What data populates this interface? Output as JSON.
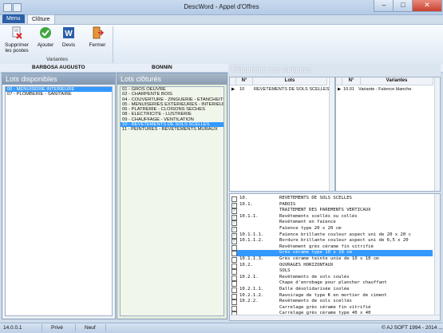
{
  "window": {
    "title": "DescWord - Appel d'Offres"
  },
  "ribbon": {
    "tabs": [
      "Menu",
      "Clôture"
    ],
    "buttons": {
      "supprimer": "Supprimer les postes",
      "ajouter": "Ajouter",
      "devis": "Devis",
      "fermer": "Fermer"
    },
    "group_label": "Variantes"
  },
  "header": {
    "left_name": "BARBOSA AUGUSTO",
    "mid_name": "BONNIN"
  },
  "lots_disponibles": {
    "title": "Lots disponibles",
    "items": [
      "06 - MENUISERIE INTÉRIEURE",
      "07 - PLOMBERIE - SANITAIRE"
    ],
    "selected_index": 0
  },
  "lots_clotures": {
    "title": "Lots clôturés",
    "items": [
      "01 - GROS OEUVRE",
      "02 - CHARPENTE BOIS",
      "04 - COUVERTURE - ZINGUERIE - ETANCHEITE",
      "05 - MENUISERIES EXTERIEURES - INTERIEURES",
      "06 - PLATRERIE - CLOISONS SECHES",
      "08 - ELECTRICITE - LUSTRERIE",
      "09 - CHAUFFAGE - VENTILATION",
      "10 - REVETEMENTS DE SOLS SCELLES",
      "11 - PEINTURES - REVETEMENTS MURAUX"
    ],
    "selected_index": 7
  },
  "repartition": {
    "title": "Répartition des variantes",
    "lots_grid": {
      "headers": [
        "N°",
        "Lots"
      ],
      "rows": [
        {
          "num": "10",
          "label": "REVETEMENTS DE SOLS SCELLES"
        }
      ]
    },
    "variantes_grid": {
      "headers": [
        "N°",
        "Variantes"
      ],
      "rows": [
        {
          "num": "10.01",
          "label": "Variante : Faïence blanche"
        }
      ]
    }
  },
  "tree": {
    "selected_index": 9,
    "rows": [
      {
        "checked": false,
        "num": "10.",
        "label": "REVETEMENTS DE SOLS SCELLES"
      },
      {
        "checked": true,
        "num": "10.1.",
        "label": "PAROIS"
      },
      {
        "checked": true,
        "num": "",
        "label": "TRAITEMENT DES PAREMENTS VERTICAUX"
      },
      {
        "checked": true,
        "num": "10.1.1.",
        "label": "Revêtements scellés ou collés"
      },
      {
        "checked": true,
        "num": "",
        "label": "Revêtement en faïence"
      },
      {
        "checked": true,
        "num": "",
        "label": "Faïence type 20 x 20 cm"
      },
      {
        "checked": true,
        "num": "10.1.1.1.",
        "label": "Faïence brillante couleur aspect uni de 20 x 20 c"
      },
      {
        "checked": true,
        "num": "10.1.1.2.",
        "label": "Bordure brillante couleur aspect uni de 6,5 x 20"
      },
      {
        "checked": false,
        "num": "",
        "label": "Revêtement grès cérame fin vitrifié"
      },
      {
        "checked": false,
        "num": "",
        "label": "Grès cérame type 10 x 10 cm"
      },
      {
        "checked": false,
        "num": "10.1.1.3.",
        "label": "Grès cérame teinte unie de 10 x 10 cm"
      },
      {
        "checked": false,
        "num": "10.2.",
        "label": "OUVRAGES HORIZONTAUX"
      },
      {
        "checked": false,
        "num": "",
        "label": "SOLS"
      },
      {
        "checked": false,
        "num": "10.2.1.",
        "label": "Revêtements de sols coulés"
      },
      {
        "checked": false,
        "num": "",
        "label": "Chape d'enrobage pour plancher chauffant"
      },
      {
        "checked": false,
        "num": "10.2.1.1.",
        "label": "Dalle désolidarisée isolée"
      },
      {
        "checked": false,
        "num": "10.2.1.2.",
        "label": "Ravoirage de type K en mortier de ciment"
      },
      {
        "checked": false,
        "num": "10.2.2.",
        "label": "Revêtements de sols scellés"
      },
      {
        "checked": false,
        "num": "",
        "label": "Carrelage grès cérame fin vitrifié"
      },
      {
        "checked": false,
        "num": "",
        "label": "Carrelage grès cérame type 40 x 40"
      }
    ]
  },
  "status": {
    "version": "14.0.0.1",
    "mode": "Privé",
    "state": "Neuf",
    "copyright": "© AJ SOFT 1994 - 2014 ..."
  }
}
